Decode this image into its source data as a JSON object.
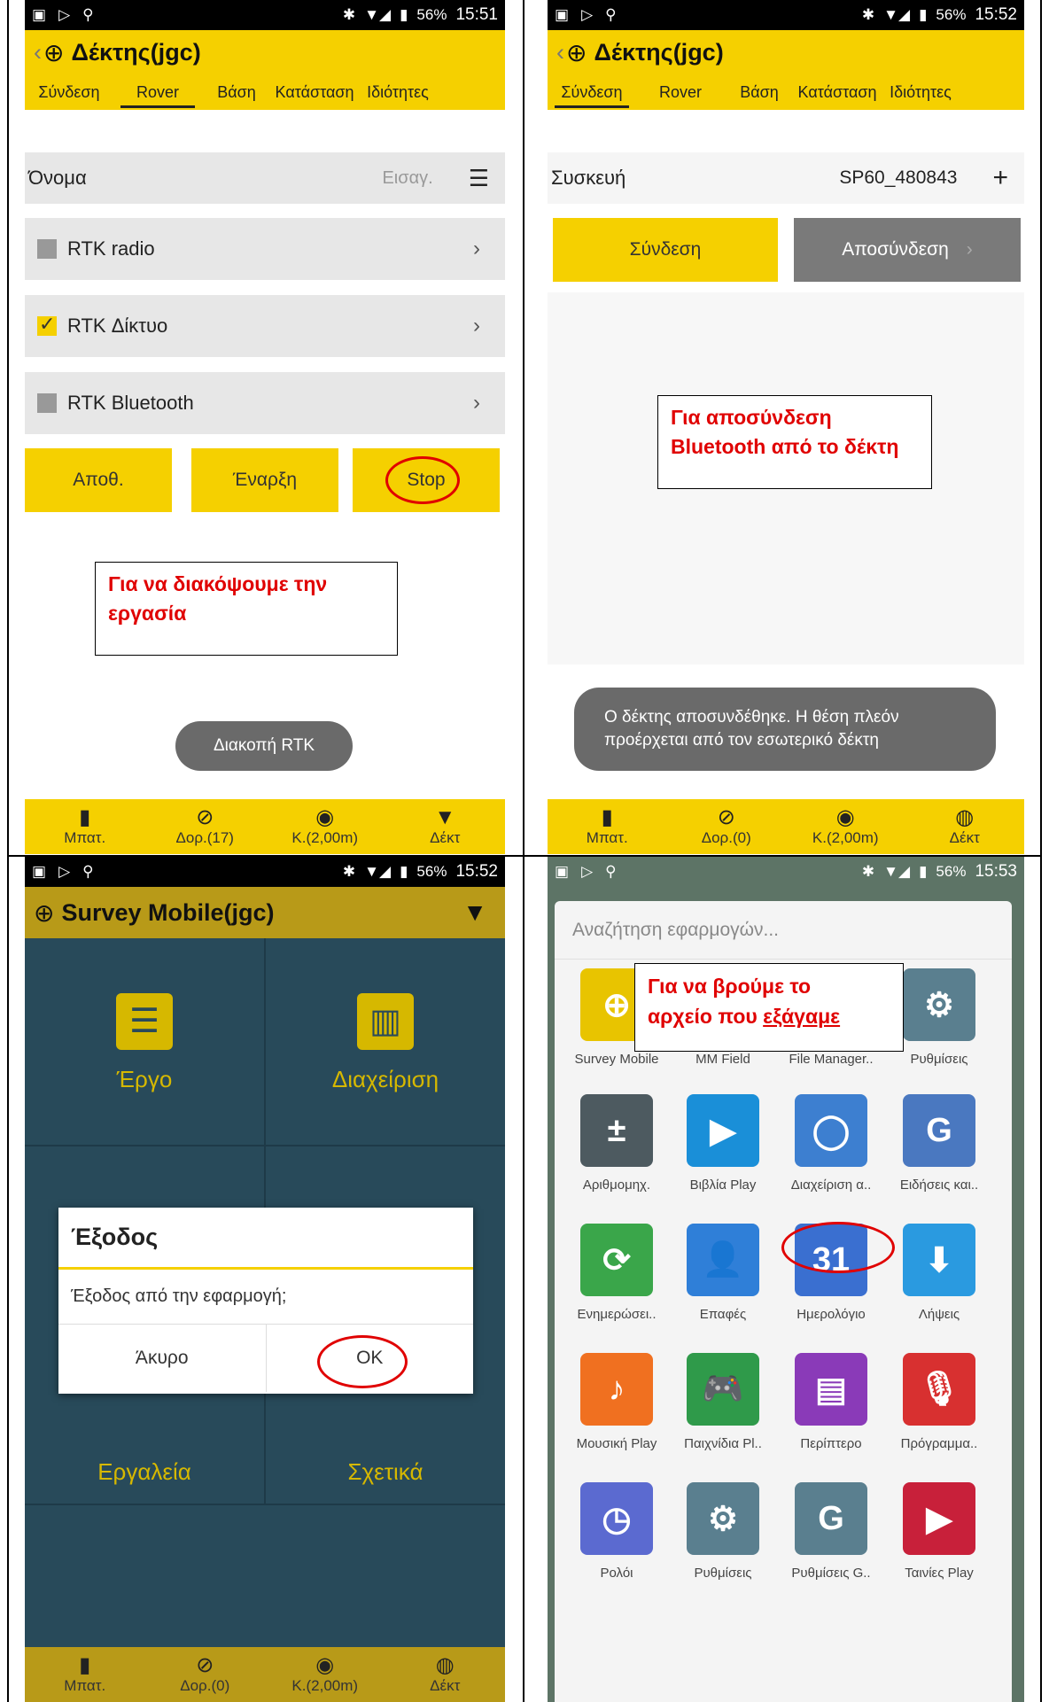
{
  "panel1": {
    "status": {
      "left_icons": [
        "notification-icon",
        "play-store-icon",
        "location-icon"
      ],
      "battery_pct": "56%",
      "time": "15:51"
    },
    "title": "Δέκτης(jgc)",
    "tabs": [
      "Σύνδεση",
      "Rover",
      "Βάση",
      "Κατάσταση",
      "Ιδιότητες"
    ],
    "name_label": "Όνομα",
    "name_placeholder": "Εισαγ.",
    "options": [
      {
        "label": "RTK radio",
        "checked": false
      },
      {
        "label": "RTK Δίκτυο",
        "checked": true
      },
      {
        "label": "RTK Bluetooth",
        "checked": false
      }
    ],
    "buttons": [
      "Αποθ.",
      "Έναρξη",
      "Stop"
    ],
    "note": "Για να διακόψουμε την εργασία",
    "toast": "Διακοπή RTK",
    "bottom": [
      "Μπατ.",
      "Δορ.(17)",
      "Κ.(2,00m)",
      "Δέκτ"
    ]
  },
  "panel2": {
    "status": {
      "battery_pct": "56%",
      "time": "15:52"
    },
    "title": "Δέκτης(jgc)",
    "tabs": [
      "Σύνδεση",
      "Rover",
      "Βάση",
      "Κατάσταση",
      "Ιδιότητες"
    ],
    "device_label": "Συσκευή",
    "device_value": "SP60_480843",
    "connect": "Σύνδεση",
    "disconnect": "Αποσύνδεση",
    "note": "Για αποσύνδεση Bluetooth από το δέκτη",
    "toast": "Ο δέκτης αποσυνδέθηκε. Η θέση πλεόν προέρχεται από τον εσωτερικό δέκτη",
    "bottom": [
      "Μπατ.",
      "Δορ.(0)",
      "Κ.(2,00m)",
      "Δέκτ"
    ]
  },
  "panel3": {
    "status": {
      "battery_pct": "56%",
      "time": "15:52"
    },
    "title": "Survey Mobile(jgc)",
    "tiles": [
      "Έργο",
      "Διαχείριση",
      "Εργαλεία",
      "Σχετικά"
    ],
    "dialog_title": "Έξοδος",
    "dialog_message": "Έξοδος από την εφαρμογή;",
    "cancel": "Άκυρο",
    "ok": "OK",
    "bottom": [
      "Μπατ.",
      "Δορ.(0)",
      "Κ.(2,00m)",
      "Δέκτ"
    ]
  },
  "panel4": {
    "status": {
      "battery_pct": "56%",
      "time": "15:53"
    },
    "search_placeholder": "Αναζήτηση εφαρμογών...",
    "note_line1": "Για να βρούμε το",
    "note_line2a": "αρχείο που ",
    "note_line2b": "εξάγαμε",
    "apps": [
      {
        "label": "Survey Mobile",
        "icon": "survey-mobile-icon",
        "color": "#e8c400",
        "glyph": "⊕"
      },
      {
        "label": "MM Field",
        "icon": "mm-field-icon",
        "color": "#2d5fa8",
        "glyph": "▲"
      },
      {
        "label": "File Manager..",
        "icon": "file-manager-icon",
        "color": "#8bb84a",
        "glyph": "HD"
      },
      {
        "label": "Ρυθμίσεις",
        "icon": "settings-icon",
        "color": "#5a7f8f",
        "glyph": "⚙"
      },
      {
        "label": "Αριθμομηχ.",
        "icon": "calculator-icon",
        "color": "#4d5a60",
        "glyph": "±"
      },
      {
        "label": "Βιβλία Play",
        "icon": "play-books-icon",
        "color": "#1a8fd8",
        "glyph": "▶"
      },
      {
        "label": "Διαχείριση α..",
        "icon": "file-manager-o-icon",
        "color": "#3d7fd0",
        "glyph": "◯"
      },
      {
        "label": "Ειδήσεις και..",
        "icon": "news-icon",
        "color": "#4a78c0",
        "glyph": "G"
      },
      {
        "label": "Ενημερώσει..",
        "icon": "updates-icon",
        "color": "#3aa64a",
        "glyph": "⟳"
      },
      {
        "label": "Επαφές",
        "icon": "contacts-icon",
        "color": "#2f7fd8",
        "glyph": "👤"
      },
      {
        "label": "Ημερολόγιο",
        "icon": "calendar-icon",
        "color": "#3a6fd0",
        "glyph": "31"
      },
      {
        "label": "Λήψεις",
        "icon": "downloads-icon",
        "color": "#2a9ae0",
        "glyph": "⬇"
      },
      {
        "label": "Μουσική Play",
        "icon": "play-music-icon",
        "color": "#f07020",
        "glyph": "♪"
      },
      {
        "label": "Παιχνίδια Pl..",
        "icon": "play-games-icon",
        "color": "#2f9a4a",
        "glyph": "🎮"
      },
      {
        "label": "Περίπτερο",
        "icon": "newsstand-icon",
        "color": "#8a3ab8",
        "glyph": "▤"
      },
      {
        "label": "Πρόγραμμα..",
        "icon": "recorder-icon",
        "color": "#d83030",
        "glyph": "🎙"
      },
      {
        "label": "Ρολόι",
        "icon": "clock-icon",
        "color": "#5b6ad0",
        "glyph": "◷"
      },
      {
        "label": "Ρυθμίσεις",
        "icon": "settings-icon",
        "color": "#5a7f8f",
        "glyph": "⚙"
      },
      {
        "label": "Ρυθμίσεις G..",
        "icon": "google-settings-icon",
        "color": "#5a7f8f",
        "glyph": "G"
      },
      {
        "label": "Ταινίες Play",
        "icon": "play-movies-icon",
        "color": "#c8203a",
        "glyph": "▶"
      }
    ]
  }
}
